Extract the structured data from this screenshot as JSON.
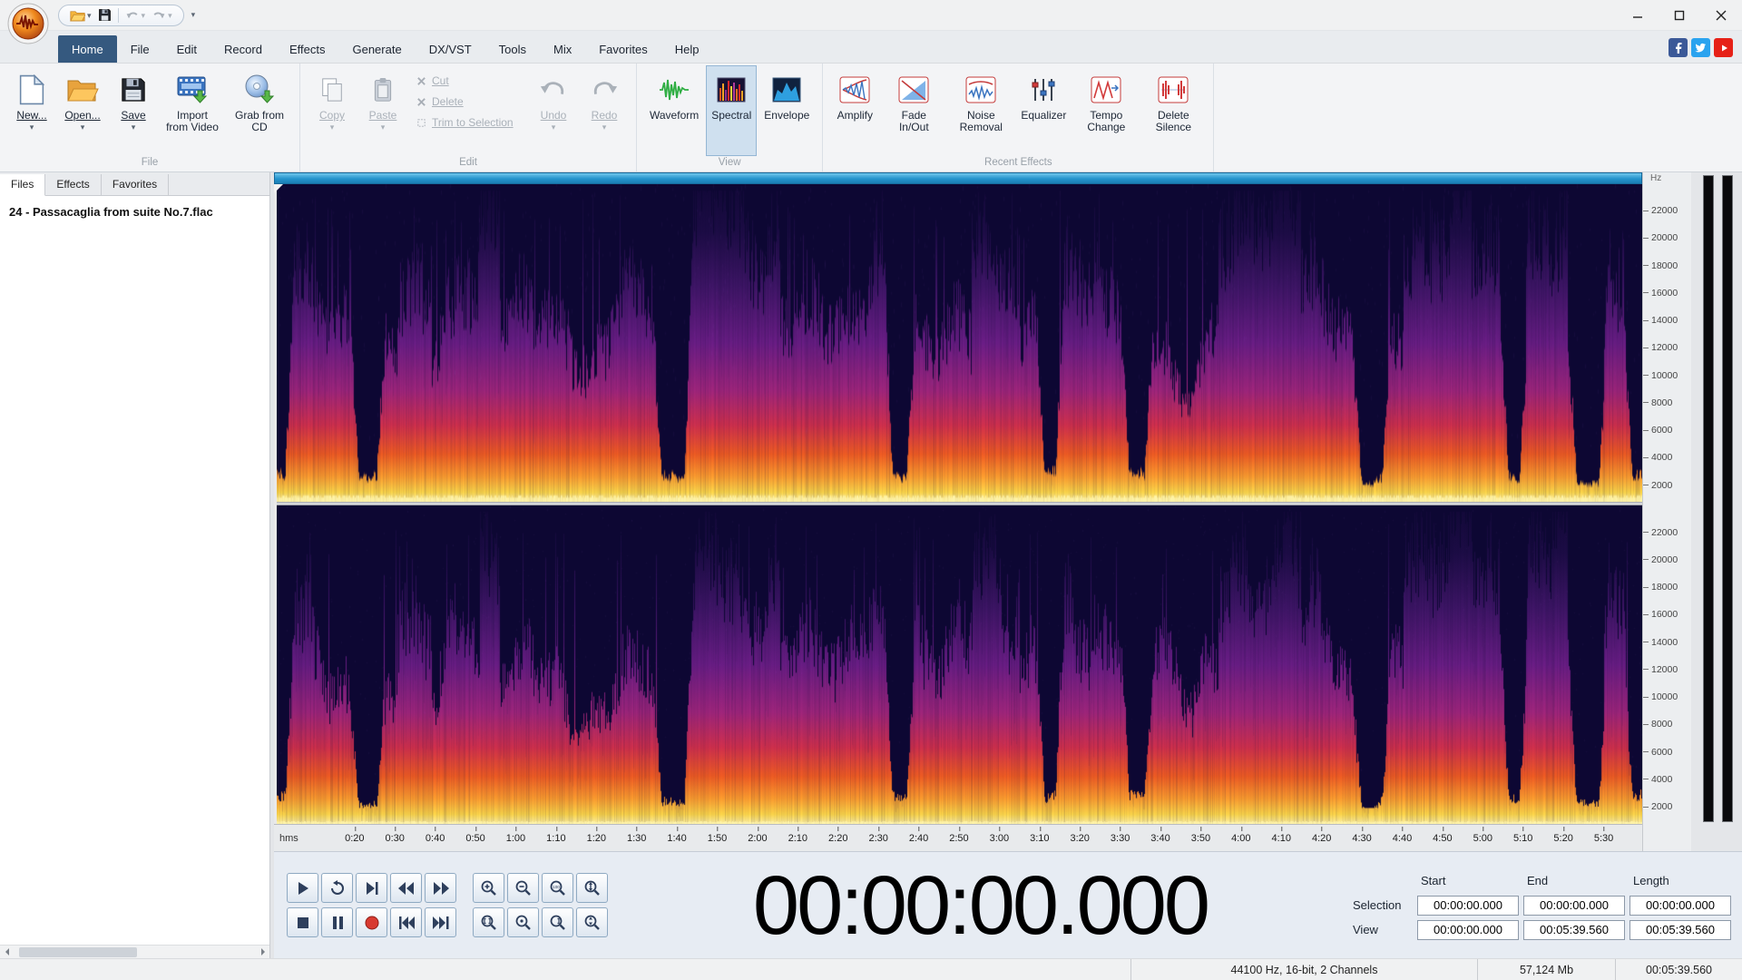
{
  "icons": {
    "caret": "▾"
  },
  "tabs": {
    "items": [
      {
        "label": "Home",
        "active": true
      },
      {
        "label": "File"
      },
      {
        "label": "Edit"
      },
      {
        "label": "Record"
      },
      {
        "label": "Effects"
      },
      {
        "label": "Generate"
      },
      {
        "label": "DX/VST"
      },
      {
        "label": "Tools"
      },
      {
        "label": "Mix"
      },
      {
        "label": "Favorites"
      },
      {
        "label": "Help"
      }
    ]
  },
  "ribbon": {
    "file_group": {
      "label": "File",
      "new": "New...",
      "open": "Open...",
      "save": "Save",
      "import": "Import from Video",
      "grab": "Grab from CD"
    },
    "edit_group": {
      "label": "Edit",
      "copy": "Copy",
      "paste": "Paste",
      "cut": "Cut",
      "delete": "Delete",
      "trim": "Trim to Selection",
      "undo": "Undo",
      "redo": "Redo"
    },
    "view_group": {
      "label": "View",
      "waveform": "Waveform",
      "spectral": "Spectral",
      "envelope": "Envelope"
    },
    "effects_group": {
      "label": "Recent Effects",
      "amplify": "Amplify",
      "fade": "Fade In/Out",
      "noise": "Noise Removal",
      "equalizer": "Equalizer",
      "tempo": "Tempo Change",
      "silence": "Delete Silence"
    }
  },
  "sidebar": {
    "tabs": [
      {
        "label": "Files",
        "active": true
      },
      {
        "label": "Effects"
      },
      {
        "label": "Favorites"
      }
    ],
    "files": [
      "24 - Passacaglia from suite No.7.flac"
    ]
  },
  "spectrogram": {
    "unit": "Hz",
    "freq_labels": [
      "22000",
      "20000",
      "18000",
      "16000",
      "14000",
      "12000",
      "10000",
      "8000",
      "6000",
      "4000",
      "2000"
    ]
  },
  "ruler": {
    "unit": "hms",
    "duration_s": 339.56,
    "labels": [
      "0:20",
      "0:30",
      "0:40",
      "0:50",
      "1:00",
      "1:10",
      "1:20",
      "1:30",
      "1:40",
      "1:50",
      "2:00",
      "2:10",
      "2:20",
      "2:30",
      "2:40",
      "2:50",
      "3:00",
      "3:10",
      "3:20",
      "3:30",
      "3:40",
      "3:50",
      "4:00",
      "4:10",
      "4:20",
      "4:30",
      "4:40",
      "4:50",
      "5:00",
      "5:10",
      "5:20",
      "5:30"
    ]
  },
  "time_display": "00:00:00.000",
  "selection_panel": {
    "headers": [
      "Start",
      "End",
      "Length"
    ],
    "rows": [
      {
        "label": "Selection",
        "start": "00:00:00.000",
        "end": "00:00:00.000",
        "length": "00:00:00.000"
      },
      {
        "label": "View",
        "start": "00:00:00.000",
        "end": "00:05:39.560",
        "length": "00:05:39.560"
      }
    ]
  },
  "statusbar": {
    "format": "44100 Hz,  16-bit,  2 Channels",
    "size": "57,124 Mb",
    "length": "00:05:39.560"
  }
}
